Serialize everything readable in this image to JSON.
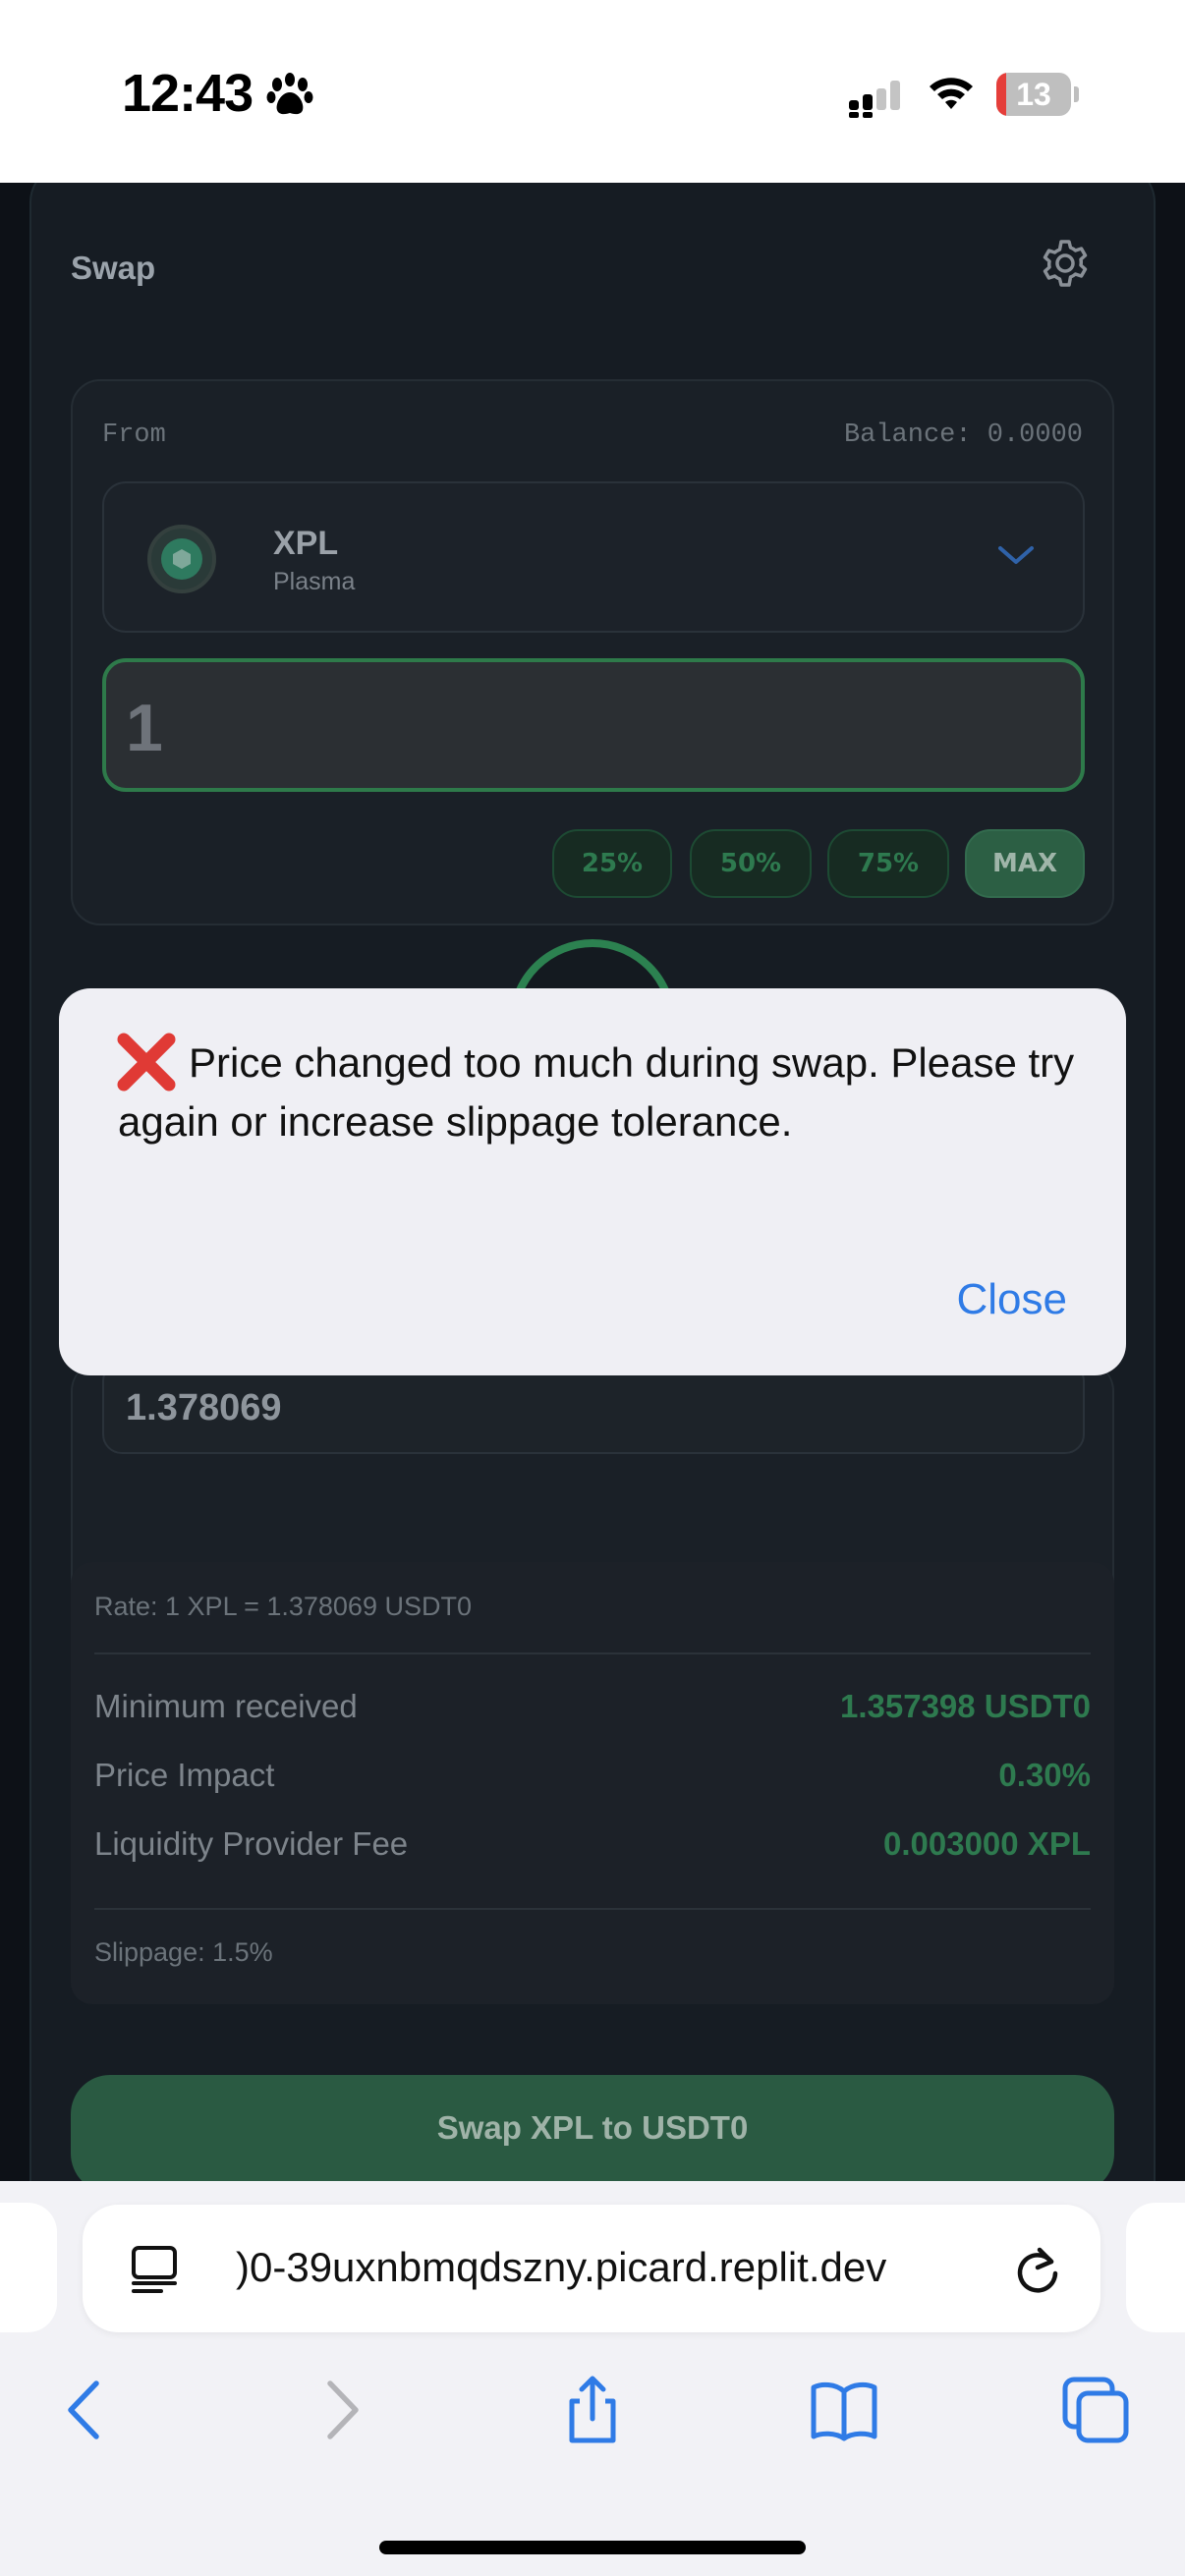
{
  "status_bar": {
    "time": "12:43",
    "battery": "13",
    "battery_level": 0.13
  },
  "swap": {
    "title": "Swap",
    "from_label": "From",
    "balance": "Balance: 0.0000",
    "token_symbol": "XPL",
    "token_name": "Plasma",
    "amount": "1",
    "percent_buttons": [
      "25%",
      "50%",
      "75%",
      "MAX"
    ],
    "to_amount": "1.378069",
    "rate": "Rate: 1 XPL = 1.378069 USDT0",
    "details": [
      {
        "label": "Minimum received",
        "value": "1.357398 USDT0"
      },
      {
        "label": "Price Impact",
        "value": "0.30%"
      },
      {
        "label": "Liquidity Provider Fee",
        "value": "0.003000 XPL"
      }
    ],
    "slippage": "Slippage: 1.5%",
    "swap_button": "Swap XPL to USDT0"
  },
  "alert": {
    "message": "Price changed too much during swap. Please try again or increase slippage tolerance.",
    "close_label": "Close"
  },
  "browser": {
    "url": ")0-39uxnbmqdszny.picard.replit.dev"
  },
  "colors": {
    "accent_green": "#2e7a4f",
    "ios_blue": "#2f7be6",
    "error_red": "#e03a35"
  }
}
